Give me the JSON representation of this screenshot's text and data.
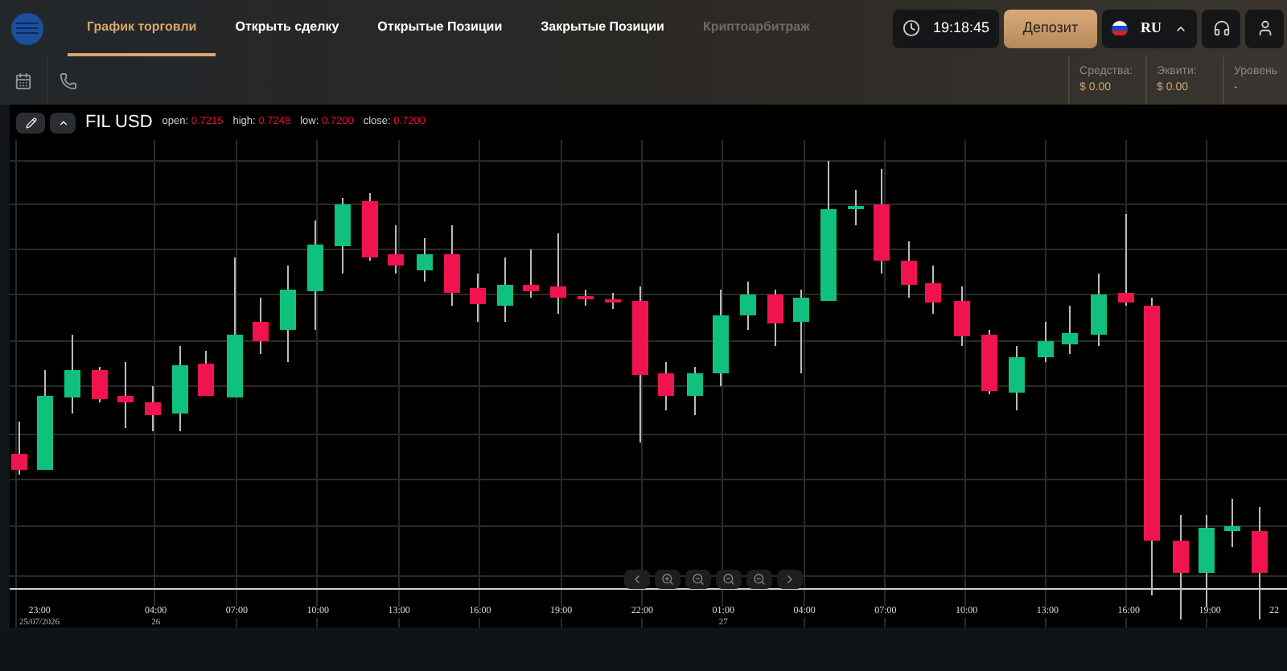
{
  "nav": {
    "tabs": [
      {
        "label": "График торговли",
        "selected": true,
        "disabled": false
      },
      {
        "label": "Открыть сделку",
        "selected": false,
        "disabled": false
      },
      {
        "label": "Открытые Позиции",
        "selected": false,
        "disabled": false
      },
      {
        "label": "Закрытые Позиции",
        "selected": false,
        "disabled": false
      },
      {
        "label": "Криптоарбитраж",
        "selected": false,
        "disabled": true
      }
    ],
    "clock": "19:18:45",
    "deposit_button": "Депозит",
    "language": "RU"
  },
  "account": [
    {
      "label": "Средства:",
      "value": "$ 0.00"
    },
    {
      "label": "Эквити:",
      "value": "$ 0.00"
    },
    {
      "label": "Уровень",
      "value": "-"
    }
  ],
  "chart": {
    "symbol": "FIL USD",
    "ohlc": [
      {
        "label": "open:",
        "value": "0.7215"
      },
      {
        "label": "high:",
        "value": "0.7248"
      },
      {
        "label": "low:",
        "value": "0.7200"
      },
      {
        "label": "close:",
        "value": "0.7200"
      }
    ],
    "time_axis": [
      {
        "time": "23:00",
        "date": "25/07/2026"
      },
      {
        "time": "04:00",
        "date": "26"
      },
      {
        "time": "07:00"
      },
      {
        "time": "10:00"
      },
      {
        "time": "13:00"
      },
      {
        "time": "16:00"
      },
      {
        "time": "19:00"
      },
      {
        "time": "22:00"
      },
      {
        "time": "01:00",
        "date": "27"
      },
      {
        "time": "04:00"
      },
      {
        "time": "07:00"
      },
      {
        "time": "10:00"
      },
      {
        "time": "13:00"
      },
      {
        "time": "16:00"
      },
      {
        "time": "19:00"
      },
      {
        "time": "22"
      }
    ]
  }
}
